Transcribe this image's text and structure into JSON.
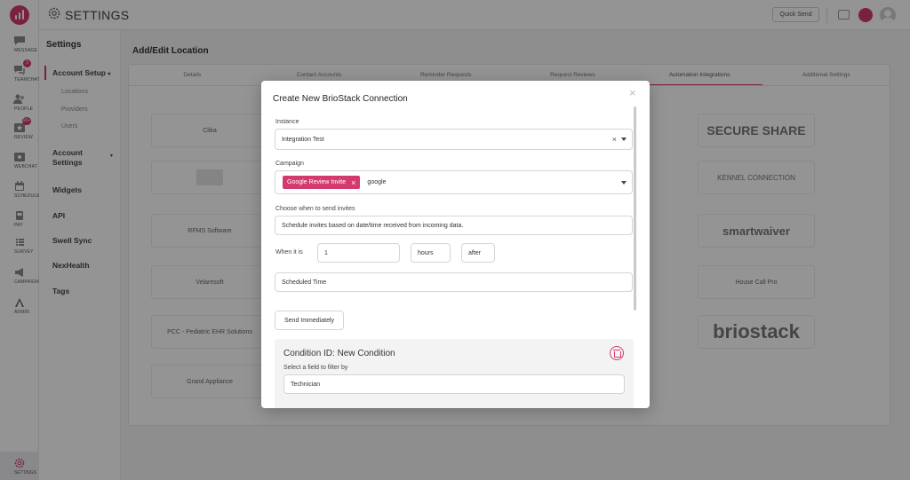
{
  "app": {
    "title": "SETTINGS",
    "quick_send": "Quick Send"
  },
  "rail": [
    {
      "label": "MESSAGE",
      "icon": "message-icon"
    },
    {
      "label": "TEAMCHAT",
      "icon": "teamchat-icon",
      "badge": "3"
    },
    {
      "label": "PEOPLE",
      "icon": "people-icon"
    },
    {
      "label": "REVIEW",
      "icon": "review-icon",
      "badge": "10+"
    },
    {
      "label": "WEBCHAT",
      "icon": "webchat-icon"
    },
    {
      "label": "SCHEDULE",
      "icon": "calendar-icon"
    },
    {
      "label": "PAY",
      "icon": "pay-icon"
    },
    {
      "label": "SURVEY",
      "icon": "survey-icon"
    },
    {
      "label": "CAMPAIGN",
      "icon": "megaphone-icon"
    },
    {
      "label": "ADMIN",
      "icon": "admin-icon"
    }
  ],
  "rail_settings": "SETTINGS",
  "nav": {
    "heading": "Settings",
    "account_setup": "Account Setup",
    "sub": [
      "Locations",
      "Providers",
      "Users"
    ],
    "account_settings_1": "Account",
    "account_settings_2": "Settings",
    "widgets": "Widgets",
    "api": "API",
    "swell_sync": "Swell Sync",
    "nexhealth": "NexHealth",
    "tags": "Tags"
  },
  "main": {
    "title": "Add/Edit Location",
    "tabs": [
      "Details",
      "Contact Accounts",
      "Reminder Requests",
      "Request Reviews",
      "Automation Integrations",
      "Additional Settings"
    ],
    "cards": [
      "Clika",
      "",
      "RFMS Software",
      "Velaresoft",
      "PCC - Pediatric EHR Solutions",
      "Grand Appliance",
      "SECURE SHARE",
      "KENNEL CONNECTION",
      "smartwaiver",
      "House Call Pro",
      "briostack"
    ]
  },
  "modal": {
    "title": "Create New BrioStack Connection",
    "close": "×",
    "instance_label": "Instance",
    "instance_value": "Integration Test",
    "campaign_label": "Campaign",
    "campaign_chip": "Google Review Invite",
    "campaign_text": "google",
    "when_label": "Choose when to send invites",
    "when_value": "Schedule invites based on date/time received from incoming data.",
    "when_it_is": "When it is",
    "amount": "1",
    "unit": "hours",
    "relation": "after",
    "time_field": "Scheduled Time",
    "send_immediately": "Send Immediately",
    "condition_title": "Condition ID: New Condition",
    "filter_label": "Select a field to filter by",
    "filter_value": "Technician"
  },
  "colors": {
    "accent": "#d33a6e"
  }
}
